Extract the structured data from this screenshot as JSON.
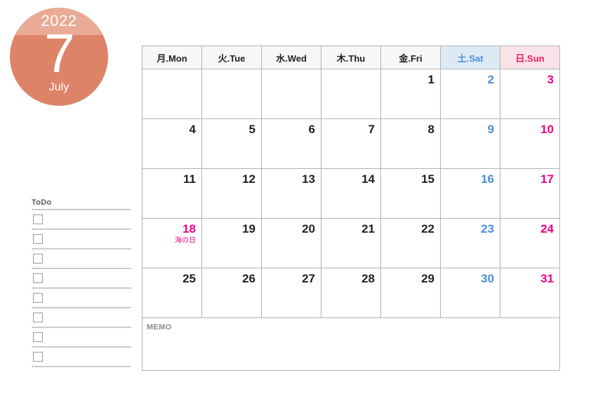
{
  "month_badge": {
    "year": "2022",
    "month_number": "7",
    "month_name": "July",
    "band_color": "#e9ab96",
    "body_color": "#dd8468",
    "text_color": "#ffffff"
  },
  "todo": {
    "title": "ToDo",
    "rows": [
      {
        "checkbox": "unchecked-checkbox",
        "text": ""
      },
      {
        "checkbox": "unchecked-checkbox",
        "text": ""
      },
      {
        "checkbox": "unchecked-checkbox",
        "text": ""
      },
      {
        "checkbox": "unchecked-checkbox",
        "text": ""
      },
      {
        "checkbox": "unchecked-checkbox",
        "text": ""
      },
      {
        "checkbox": "unchecked-checkbox",
        "text": ""
      },
      {
        "checkbox": "unchecked-checkbox",
        "text": ""
      },
      {
        "checkbox": "unchecked-checkbox",
        "text": ""
      }
    ]
  },
  "calendar": {
    "weekday_headers": [
      {
        "label": "月.Mon",
        "kind": "weekday"
      },
      {
        "label": "火.Tue",
        "kind": "weekday"
      },
      {
        "label": "水.Wed",
        "kind": "weekday"
      },
      {
        "label": "木.Thu",
        "kind": "weekday"
      },
      {
        "label": "金.Fri",
        "kind": "weekday"
      },
      {
        "label": "土.Sat",
        "kind": "saturday"
      },
      {
        "label": "日.Sun",
        "kind": "sunday"
      }
    ],
    "weeks": [
      [
        {
          "date": "",
          "kind": "weekday",
          "note": ""
        },
        {
          "date": "",
          "kind": "weekday",
          "note": ""
        },
        {
          "date": "",
          "kind": "weekday",
          "note": ""
        },
        {
          "date": "",
          "kind": "weekday",
          "note": ""
        },
        {
          "date": "1",
          "kind": "weekday",
          "note": ""
        },
        {
          "date": "2",
          "kind": "saturday",
          "note": ""
        },
        {
          "date": "3",
          "kind": "sunday",
          "note": ""
        }
      ],
      [
        {
          "date": "4",
          "kind": "weekday",
          "note": ""
        },
        {
          "date": "5",
          "kind": "weekday",
          "note": ""
        },
        {
          "date": "6",
          "kind": "weekday",
          "note": ""
        },
        {
          "date": "7",
          "kind": "weekday",
          "note": ""
        },
        {
          "date": "8",
          "kind": "weekday",
          "note": ""
        },
        {
          "date": "9",
          "kind": "saturday",
          "note": ""
        },
        {
          "date": "10",
          "kind": "sunday",
          "note": ""
        }
      ],
      [
        {
          "date": "11",
          "kind": "weekday",
          "note": ""
        },
        {
          "date": "12",
          "kind": "weekday",
          "note": ""
        },
        {
          "date": "13",
          "kind": "weekday",
          "note": ""
        },
        {
          "date": "14",
          "kind": "weekday",
          "note": ""
        },
        {
          "date": "15",
          "kind": "weekday",
          "note": ""
        },
        {
          "date": "16",
          "kind": "saturday",
          "note": ""
        },
        {
          "date": "17",
          "kind": "sunday",
          "note": ""
        }
      ],
      [
        {
          "date": "18",
          "kind": "holiday",
          "note": "海の日"
        },
        {
          "date": "19",
          "kind": "weekday",
          "note": ""
        },
        {
          "date": "20",
          "kind": "weekday",
          "note": ""
        },
        {
          "date": "21",
          "kind": "weekday",
          "note": ""
        },
        {
          "date": "22",
          "kind": "weekday",
          "note": ""
        },
        {
          "date": "23",
          "kind": "saturday",
          "note": ""
        },
        {
          "date": "24",
          "kind": "sunday",
          "note": ""
        }
      ],
      [
        {
          "date": "25",
          "kind": "weekday",
          "note": ""
        },
        {
          "date": "26",
          "kind": "weekday",
          "note": ""
        },
        {
          "date": "27",
          "kind": "weekday",
          "note": ""
        },
        {
          "date": "28",
          "kind": "weekday",
          "note": ""
        },
        {
          "date": "29",
          "kind": "weekday",
          "note": ""
        },
        {
          "date": "30",
          "kind": "saturday",
          "note": ""
        },
        {
          "date": "31",
          "kind": "sunday",
          "note": ""
        }
      ]
    ],
    "memo_label": "MEMO",
    "colors": {
      "saturday_text": "#4a90d9",
      "saturday_header_bg": "#dceaf5",
      "sunday_text": "#ec008c",
      "sunday_header_bg": "#f9e3e8",
      "sunday_header_text": "#ec1c62",
      "weekday_header_bg": "#f7f7f7",
      "grid_line": "#b3b3b3",
      "memo_text": "#8a8a8a"
    }
  }
}
